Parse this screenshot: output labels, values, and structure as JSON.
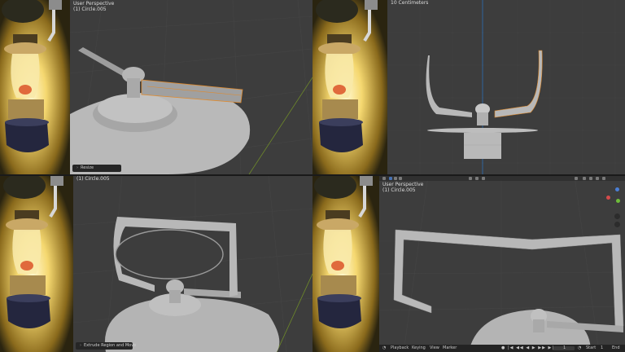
{
  "views": {
    "top_left": {
      "line1": "User Perspective",
      "line2": "(1) Circle.005",
      "operator": "Resize"
    },
    "top_right": {
      "line1": "10 Centimeters"
    },
    "bottom_left": {
      "line1": "(1) Circle.005",
      "operator": "Extrude Region and Move"
    },
    "bottom_right": {
      "line1": "User Perspective",
      "line2": "(1) Circle.005"
    }
  },
  "timeline": {
    "menu_playback": "Playback",
    "menu_keying": "Keying",
    "menu_view": "View",
    "menu_marker": "Marker",
    "current_frame": "1",
    "start_label": "Start",
    "start_value": "1",
    "end_label": "End"
  },
  "icons": {
    "transport": "play-controls-icon",
    "timeline_editor": "clock-icon",
    "gizmo": "axis-gizmo-icon"
  },
  "colors": {
    "viewport_bg": "#3d3d3d",
    "selection": "#e08a2c",
    "mesh": "#b8b8b8",
    "lamp_glow": "#f5d870",
    "lamp_base": "#24263e"
  }
}
